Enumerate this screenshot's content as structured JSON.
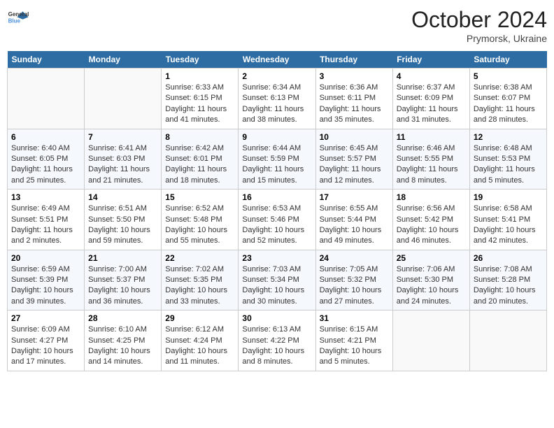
{
  "header": {
    "logo_line1": "General",
    "logo_line2": "Blue",
    "month": "October 2024",
    "location": "Prymorsk, Ukraine"
  },
  "days_of_week": [
    "Sunday",
    "Monday",
    "Tuesday",
    "Wednesday",
    "Thursday",
    "Friday",
    "Saturday"
  ],
  "weeks": [
    [
      {
        "day": "",
        "info": ""
      },
      {
        "day": "",
        "info": ""
      },
      {
        "day": "1",
        "info": "Sunrise: 6:33 AM\nSunset: 6:15 PM\nDaylight: 11 hours and 41 minutes."
      },
      {
        "day": "2",
        "info": "Sunrise: 6:34 AM\nSunset: 6:13 PM\nDaylight: 11 hours and 38 minutes."
      },
      {
        "day": "3",
        "info": "Sunrise: 6:36 AM\nSunset: 6:11 PM\nDaylight: 11 hours and 35 minutes."
      },
      {
        "day": "4",
        "info": "Sunrise: 6:37 AM\nSunset: 6:09 PM\nDaylight: 11 hours and 31 minutes."
      },
      {
        "day": "5",
        "info": "Sunrise: 6:38 AM\nSunset: 6:07 PM\nDaylight: 11 hours and 28 minutes."
      }
    ],
    [
      {
        "day": "6",
        "info": "Sunrise: 6:40 AM\nSunset: 6:05 PM\nDaylight: 11 hours and 25 minutes."
      },
      {
        "day": "7",
        "info": "Sunrise: 6:41 AM\nSunset: 6:03 PM\nDaylight: 11 hours and 21 minutes."
      },
      {
        "day": "8",
        "info": "Sunrise: 6:42 AM\nSunset: 6:01 PM\nDaylight: 11 hours and 18 minutes."
      },
      {
        "day": "9",
        "info": "Sunrise: 6:44 AM\nSunset: 5:59 PM\nDaylight: 11 hours and 15 minutes."
      },
      {
        "day": "10",
        "info": "Sunrise: 6:45 AM\nSunset: 5:57 PM\nDaylight: 11 hours and 12 minutes."
      },
      {
        "day": "11",
        "info": "Sunrise: 6:46 AM\nSunset: 5:55 PM\nDaylight: 11 hours and 8 minutes."
      },
      {
        "day": "12",
        "info": "Sunrise: 6:48 AM\nSunset: 5:53 PM\nDaylight: 11 hours and 5 minutes."
      }
    ],
    [
      {
        "day": "13",
        "info": "Sunrise: 6:49 AM\nSunset: 5:51 PM\nDaylight: 11 hours and 2 minutes."
      },
      {
        "day": "14",
        "info": "Sunrise: 6:51 AM\nSunset: 5:50 PM\nDaylight: 10 hours and 59 minutes."
      },
      {
        "day": "15",
        "info": "Sunrise: 6:52 AM\nSunset: 5:48 PM\nDaylight: 10 hours and 55 minutes."
      },
      {
        "day": "16",
        "info": "Sunrise: 6:53 AM\nSunset: 5:46 PM\nDaylight: 10 hours and 52 minutes."
      },
      {
        "day": "17",
        "info": "Sunrise: 6:55 AM\nSunset: 5:44 PM\nDaylight: 10 hours and 49 minutes."
      },
      {
        "day": "18",
        "info": "Sunrise: 6:56 AM\nSunset: 5:42 PM\nDaylight: 10 hours and 46 minutes."
      },
      {
        "day": "19",
        "info": "Sunrise: 6:58 AM\nSunset: 5:41 PM\nDaylight: 10 hours and 42 minutes."
      }
    ],
    [
      {
        "day": "20",
        "info": "Sunrise: 6:59 AM\nSunset: 5:39 PM\nDaylight: 10 hours and 39 minutes."
      },
      {
        "day": "21",
        "info": "Sunrise: 7:00 AM\nSunset: 5:37 PM\nDaylight: 10 hours and 36 minutes."
      },
      {
        "day": "22",
        "info": "Sunrise: 7:02 AM\nSunset: 5:35 PM\nDaylight: 10 hours and 33 minutes."
      },
      {
        "day": "23",
        "info": "Sunrise: 7:03 AM\nSunset: 5:34 PM\nDaylight: 10 hours and 30 minutes."
      },
      {
        "day": "24",
        "info": "Sunrise: 7:05 AM\nSunset: 5:32 PM\nDaylight: 10 hours and 27 minutes."
      },
      {
        "day": "25",
        "info": "Sunrise: 7:06 AM\nSunset: 5:30 PM\nDaylight: 10 hours and 24 minutes."
      },
      {
        "day": "26",
        "info": "Sunrise: 7:08 AM\nSunset: 5:28 PM\nDaylight: 10 hours and 20 minutes."
      }
    ],
    [
      {
        "day": "27",
        "info": "Sunrise: 6:09 AM\nSunset: 4:27 PM\nDaylight: 10 hours and 17 minutes."
      },
      {
        "day": "28",
        "info": "Sunrise: 6:10 AM\nSunset: 4:25 PM\nDaylight: 10 hours and 14 minutes."
      },
      {
        "day": "29",
        "info": "Sunrise: 6:12 AM\nSunset: 4:24 PM\nDaylight: 10 hours and 11 minutes."
      },
      {
        "day": "30",
        "info": "Sunrise: 6:13 AM\nSunset: 4:22 PM\nDaylight: 10 hours and 8 minutes."
      },
      {
        "day": "31",
        "info": "Sunrise: 6:15 AM\nSunset: 4:21 PM\nDaylight: 10 hours and 5 minutes."
      },
      {
        "day": "",
        "info": ""
      },
      {
        "day": "",
        "info": ""
      }
    ]
  ]
}
